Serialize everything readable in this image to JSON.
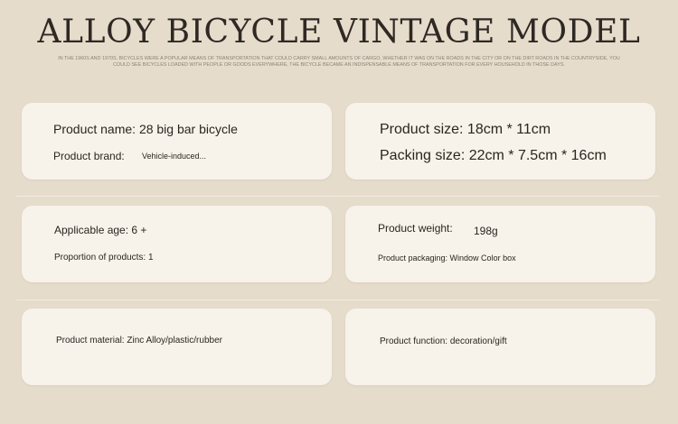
{
  "header": {
    "title": "ALLOY BICYCLE VINTAGE MODEL",
    "subtitle": "IN THE 1960S AND 1970S, BICYCLES WERE A POPULAR MEANS OF TRANSPORTATION THAT COULD CARRY SMALL AMOUNTS OF CARGO, WHETHER IT WAS ON THE ROADS IN THE CITY OR ON THE DIRT ROADS IN THE COUNTRYSIDE, YOU COULD SEE BICYCLES LOADED WITH PEOPLE OR GOODS EVERYWHERE, THE BICYCLE BECAME AN INDISPENSABLE MEANS OF TRANSPORTATION FOR EVERY HOUSEHOLD IN THOSE DAYS."
  },
  "cards": {
    "card1": {
      "line1": "Product name: 28 big bar bicycle",
      "brand_label": "Product brand:",
      "brand_value": "Vehicle-induced..."
    },
    "card2": {
      "line1": "Product size: 18cm * 11cm",
      "line2": "Packing size: 22cm * 7.5cm * 16cm"
    },
    "card3": {
      "line1": "Applicable age: 6 +",
      "line2": "Proportion of products: 1"
    },
    "card4": {
      "line1_label": "Product weight:",
      "line1_value": "198g",
      "line2": "Product packaging: Window Color box"
    },
    "card5": {
      "line1": "Product material: Zinc Alloy/plastic/rubber"
    },
    "card6": {
      "line1": "Product function: decoration/gift"
    }
  }
}
